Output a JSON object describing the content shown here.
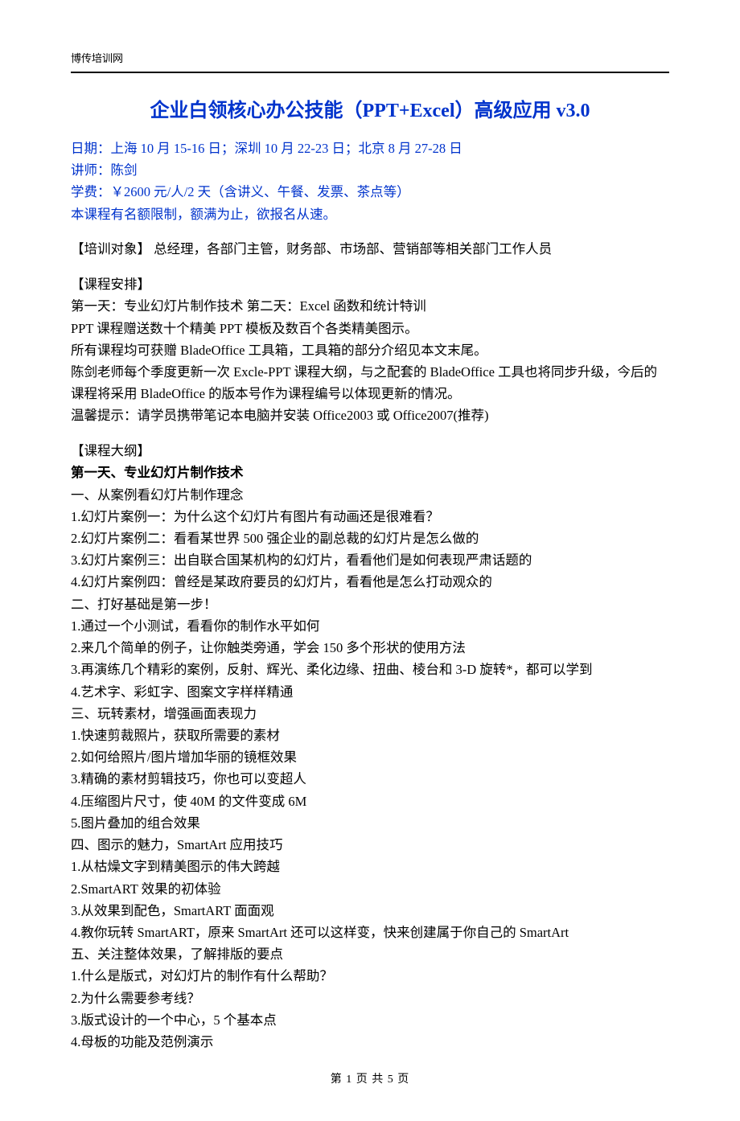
{
  "header": {
    "site": "博传培训网"
  },
  "title": "企业白领核心办公技能（PPT+Excel）高级应用 v3.0",
  "meta": {
    "date": "日期：上海 10 月 15-16 日；深圳 10 月 22-23 日；北京 8 月 27-28 日",
    "lecturer": "讲师：陈剑",
    "fee": "学费：￥2600 元/人/2 天（含讲义、午餐、发票、茶点等）",
    "quota": "本课程有名额限制，额满为止，欲报名从速。"
  },
  "audience": {
    "label": "【培训对象】",
    "text": " 总经理，各部门主管，财务部、市场部、营销部等相关部门工作人员"
  },
  "schedule": {
    "label": "【课程安排】",
    "lines": [
      "第一天：专业幻灯片制作技术    第二天：Excel 函数和统计特训",
      "PPT 课程赠送数十个精美 PPT 模板及数百个各类精美图示。",
      "所有课程均可获赠 BladeOffice 工具箱，工具箱的部分介绍见本文末尾。",
      "陈剑老师每个季度更新一次 Excle-PPT 课程大纲，与之配套的 BladeOffice 工具也将同步升级，今后的课程将采用 BladeOffice 的版本号作为课程编号以体现更新的情况。",
      "温馨提示：请学员携带笔记本电脑并安装 Office2003 或 Office2007(推荐)"
    ]
  },
  "outline": {
    "label": "【课程大纲】",
    "day1_title": "第一天、专业幻灯片制作技术",
    "sections": [
      {
        "heading": "一、从案例看幻灯片制作理念",
        "items": [
          "1.幻灯片案例一：为什么这个幻灯片有图片有动画还是很难看？",
          "2.幻灯片案例二：看看某世界 500 强企业的副总裁的幻灯片是怎么做的",
          "3.幻灯片案例三：出自联合国某机构的幻灯片，看看他们是如何表现严肃话题的",
          "4.幻灯片案例四：曾经是某政府要员的幻灯片，看看他是怎么打动观众的"
        ]
      },
      {
        "heading": "二、打好基础是第一步！",
        "items": [
          "1.通过一个小测试，看看你的制作水平如何",
          "2.来几个简单的例子，让你触类旁通，学会 150 多个形状的使用方法",
          "3.再演练几个精彩的案例，反射、辉光、柔化边缘、扭曲、棱台和 3-D 旋转*，都可以学到",
          "4.艺术字、彩虹字、图案文字样样精通"
        ]
      },
      {
        "heading": "三、玩转素材，增强画面表现力",
        "items": [
          "1.快速剪裁照片，获取所需要的素材",
          "2.如何给照片/图片增加华丽的镜框效果",
          "3.精确的素材剪辑技巧，你也可以变超人",
          "4.压缩图片尺寸，使 40M 的文件变成 6M",
          "5.图片叠加的组合效果"
        ]
      },
      {
        "heading": "四、图示的魅力，SmartArt 应用技巧",
        "items": [
          "1.从枯燥文字到精美图示的伟大跨越",
          "2.SmartART 效果的初体验",
          "3.从效果到配色，SmartART 面面观",
          "4.教你玩转 SmartART，原来 SmartArt 还可以这样变，快来创建属于你自己的 SmartArt"
        ]
      },
      {
        "heading": "五、关注整体效果，了解排版的要点",
        "items": [
          "1.什么是版式，对幻灯片的制作有什么帮助？",
          "2.为什么需要参考线？",
          "3.版式设计的一个中心，5 个基本点",
          "4.母板的功能及范例演示"
        ]
      }
    ]
  },
  "footer": {
    "page_left": "第",
    "page_cur": "1",
    "page_mid": "页 共",
    "page_total": "5",
    "page_right": "页"
  }
}
